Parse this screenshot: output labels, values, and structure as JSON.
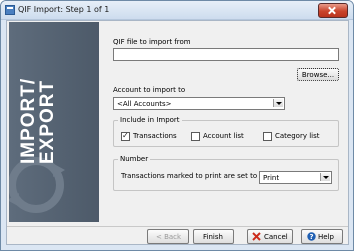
{
  "window": {
    "title": "QIF Import: Step 1 of 1"
  },
  "banner": {
    "text": "IMPORT/ EXPORT"
  },
  "file": {
    "label": "QIF file to import from",
    "value": "",
    "browse_label": "Browse..."
  },
  "account": {
    "label": "Account to import to",
    "selected": "<All Accounts>"
  },
  "include": {
    "title": "Include in Import",
    "items": [
      {
        "label": "Transactions",
        "checked": true
      },
      {
        "label": "Account list",
        "checked": false
      },
      {
        "label": "Category list",
        "checked": false
      }
    ]
  },
  "number": {
    "title": "Number",
    "label": "Transactions marked to print are set to",
    "selected": "Print"
  },
  "footer": {
    "back": "< Back",
    "finish": "Finish",
    "cancel": "Cancel",
    "help": "Help"
  },
  "colors": {
    "banner": "#56636f",
    "cancel_icon": "#cc2a1a",
    "help_icon": "#1f5fb3"
  }
}
